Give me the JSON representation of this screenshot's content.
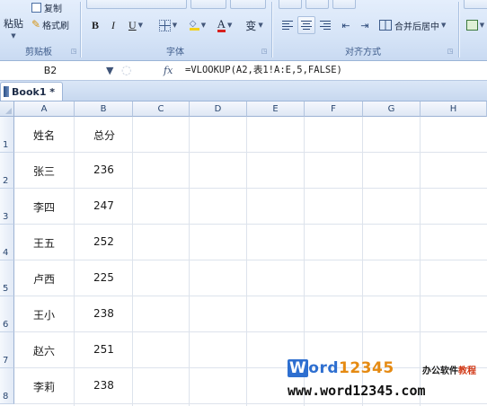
{
  "ribbon": {
    "clipboard": {
      "paste_label": "粘贴",
      "copy_label": "复制",
      "format_painter_label": "格式刷",
      "group_label": "剪贴板"
    },
    "font": {
      "bold": "B",
      "italic": "I",
      "underline": "U",
      "font_color_letter": "A",
      "phonetic_label": "变",
      "group_label": "字体"
    },
    "alignment": {
      "merge_center_label": "合并后居中",
      "group_label": "对齐方式"
    }
  },
  "formula_bar": {
    "name_box": "B2",
    "fx_label": "fx",
    "formula": "=VLOOKUP(A2,表1!A:E,5,FALSE)"
  },
  "workbook_tab": {
    "label": "Book1 *"
  },
  "columns": [
    "A",
    "B",
    "C",
    "D",
    "E",
    "F",
    "G",
    "H"
  ],
  "rows": [
    "1",
    "2",
    "3",
    "4",
    "5",
    "6",
    "7",
    "8"
  ],
  "cells": {
    "A": [
      "姓名",
      "张三",
      "李四",
      "王五",
      "卢西",
      "王小",
      "赵六",
      "李莉"
    ],
    "B": [
      "总分",
      "236",
      "247",
      "252",
      "225",
      "238",
      "251",
      "238"
    ]
  },
  "watermark": {
    "logo_letter": "W",
    "logo_rest": "ord",
    "logo_number": "12345",
    "tagline_part1": "办公软件",
    "tagline_part2": "教程",
    "url": "www.word12345.com"
  },
  "colors": {
    "accent_blue": "#2e6fd0",
    "accent_orange": "#e58a12",
    "ribbon_bg": "#d6e4f7"
  }
}
